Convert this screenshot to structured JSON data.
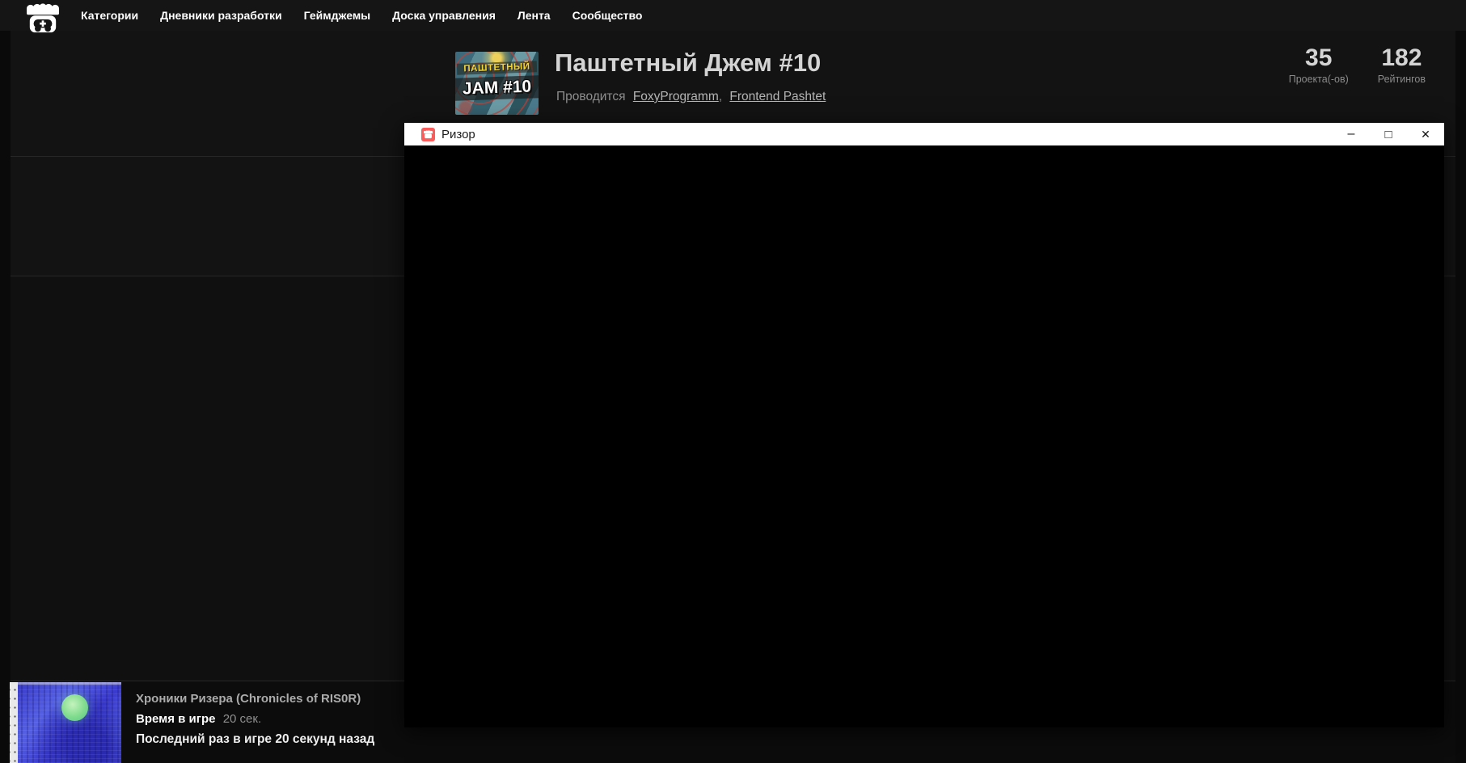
{
  "nav": {
    "logo": "itch-io-storefront",
    "items": [
      {
        "label": "Категории"
      },
      {
        "label": "Дневники разработки"
      },
      {
        "label": "Геймджемы"
      },
      {
        "label": "Доска управления"
      },
      {
        "label": "Лента"
      },
      {
        "label": "Сообщество"
      }
    ]
  },
  "jam": {
    "title": "Паштетный Джем #10",
    "hosted_prefix": "Проводится",
    "hosts": [
      {
        "name": "FoxyProgramm"
      },
      {
        "name": "Frontend Pashtet"
      }
    ],
    "separator": ",",
    "thumbnail": {
      "line1": "ПАШТЕТНЫЙ",
      "line2": "JAM #10"
    },
    "stats": [
      {
        "value": "35",
        "label": "Проекта(-ов)"
      },
      {
        "value": "182",
        "label": "Рейтингов"
      }
    ]
  },
  "game_window": {
    "title": "Ризор",
    "controls": {
      "minimize": "–",
      "maximize": "□",
      "close": "✕"
    }
  },
  "now_playing": {
    "title": "Хроники Ризера (Chronicles of RIS0R)",
    "playtime_label": "Время в игре",
    "playtime_value": "20 сек.",
    "last_played": "Последний раз в игре 20 секунд назад"
  },
  "colors": {
    "accent_red": "#fa5c5c",
    "page_bg": "#0a0a0a",
    "panel_bg": "#131313",
    "titlebar_bg": "#ffffff",
    "window_content_bg": "#000000"
  }
}
